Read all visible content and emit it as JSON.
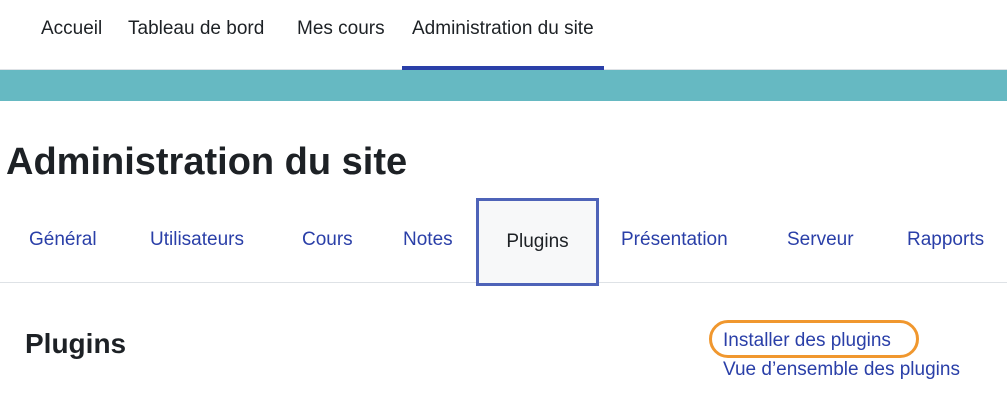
{
  "topnav": {
    "items": [
      {
        "label": "Accueil"
      },
      {
        "label": "Tableau de bord"
      },
      {
        "label": "Mes cours"
      },
      {
        "label": "Administration du site",
        "active": true
      }
    ]
  },
  "page": {
    "title": "Administration du site"
  },
  "tabs": [
    {
      "label": "Général"
    },
    {
      "label": "Utilisateurs"
    },
    {
      "label": "Cours"
    },
    {
      "label": "Notes"
    },
    {
      "label": "Plugins",
      "active": true
    },
    {
      "label": "Présentation"
    },
    {
      "label": "Serveur"
    },
    {
      "label": "Rapports"
    }
  ],
  "section": {
    "title": "Plugins",
    "links": [
      {
        "label": "Installer des plugins",
        "highlighted": true
      },
      {
        "label": "Vue d’ensemble des plugins"
      }
    ]
  },
  "colors": {
    "banner": "#66b9c2",
    "link": "#2a3fa8",
    "active_underline": "#2a3fa8",
    "active_tab_border": "#4e63b8",
    "highlight": "#f0972e"
  }
}
